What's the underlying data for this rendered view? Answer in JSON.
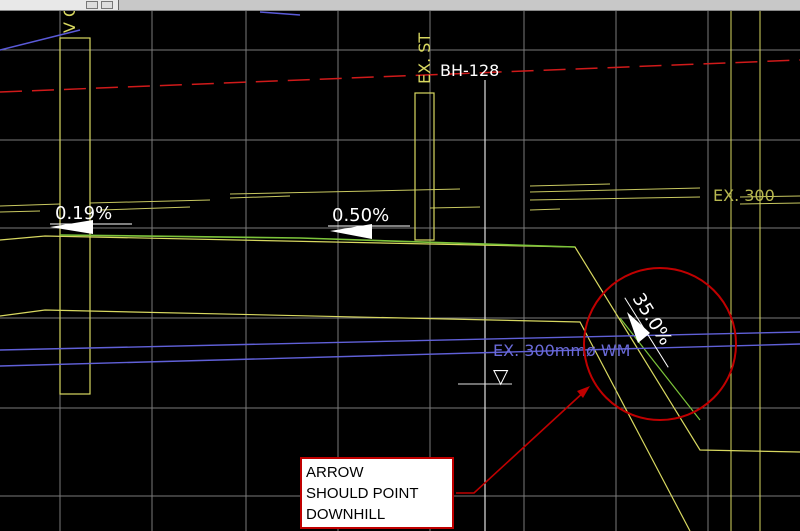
{
  "drawing": {
    "labels": {
      "slope_left": "0.19%",
      "slope_mid": "0.50%",
      "slope_steep": "35.0%",
      "borehole": "BH-128",
      "ex_pipe_blue": "EX. 300mmø WM",
      "ex_pipe_yellow": "EX. 300",
      "vertical_label": "EX. ST",
      "top_fragment": "V O",
      "water_level_symbol": "▽"
    },
    "colors": {
      "background": "#000000",
      "grid": "#8a8a8a",
      "yellow": "#d8d860",
      "green": "#7cc43a",
      "red_dash": "#d01a1a",
      "blue": "#6060d8",
      "white": "#ffffff",
      "callout_red": "#c00000"
    }
  },
  "callout": {
    "lines": [
      "ARROW",
      "SHOULD POINT",
      "DOWNHILL"
    ]
  }
}
